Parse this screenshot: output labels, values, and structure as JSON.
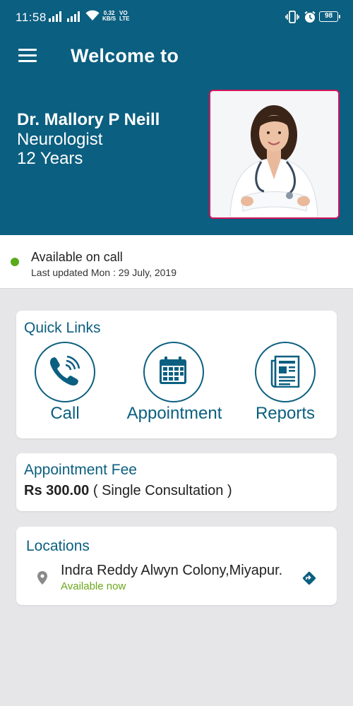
{
  "status_bar": {
    "time": "11:58",
    "net_speed_value": "0.32",
    "net_speed_unit": "KB/S",
    "volte_top": "VO",
    "volte_bottom": "LTE",
    "battery": "98"
  },
  "header": {
    "title": "Welcome to",
    "doctor_name": "Dr. Mallory P Neill",
    "specialty": "Neurologist",
    "experience": "12 Years"
  },
  "availability": {
    "status": "Available on call",
    "updated": "Last updated Mon : 29 July, 2019",
    "dot_color": "#5aaa1a"
  },
  "quick_links": {
    "title": "Quick Links",
    "items": [
      {
        "label": "Call",
        "icon": "phone-icon"
      },
      {
        "label": "Appointment",
        "icon": "calendar-icon"
      },
      {
        "label": "Reports",
        "icon": "report-icon"
      }
    ]
  },
  "fee": {
    "title": "Appointment Fee",
    "amount": "Rs 300.00",
    "note": " ( Single Consultation )"
  },
  "locations": {
    "title": "Locations",
    "address": "Indra Reddy Alwyn Colony,Miyapur.",
    "status": "Available now"
  },
  "colors": {
    "primary": "#0b5f80",
    "accent_border": "#d4145a",
    "available_green": "#6aa81b",
    "background": "#e6e5e7"
  }
}
